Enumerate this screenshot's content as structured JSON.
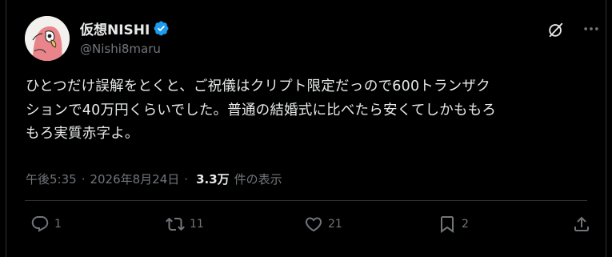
{
  "author": {
    "display_name": "仮想NISHI",
    "handle": "@Nishi8maru",
    "avatar_icon": "parrot-avatar-icon",
    "verified_icon": "verified-badge-icon",
    "verified_color": "#1d9bf0"
  },
  "tweet": {
    "text": "ひとつだけ誤解をとくと、ご祝儀はクリプト限定だっので600トランザク\nションで40万円くらいでした。普通の結婚式に比べたら安くてしかももろ\nもろ実質赤字よ。",
    "time": "午後5:35",
    "separator": "·",
    "date": "2026年8月24日",
    "views_count": "3.3万",
    "views_label": "件の表示"
  },
  "actions": {
    "reply": {
      "icon": "reply-icon",
      "count": "1"
    },
    "retweet": {
      "icon": "retweet-icon",
      "count": "11"
    },
    "like": {
      "icon": "heart-icon",
      "count": "21"
    },
    "bookmark": {
      "icon": "bookmark-icon",
      "count": "2"
    },
    "share": {
      "icon": "share-icon"
    }
  },
  "header_icons": {
    "grok": "grok-icon",
    "more": "more-icon"
  },
  "colors": {
    "background": "#000000",
    "text": "#e7e9ea",
    "secondary": "#71767b",
    "border": "#2f3336"
  }
}
